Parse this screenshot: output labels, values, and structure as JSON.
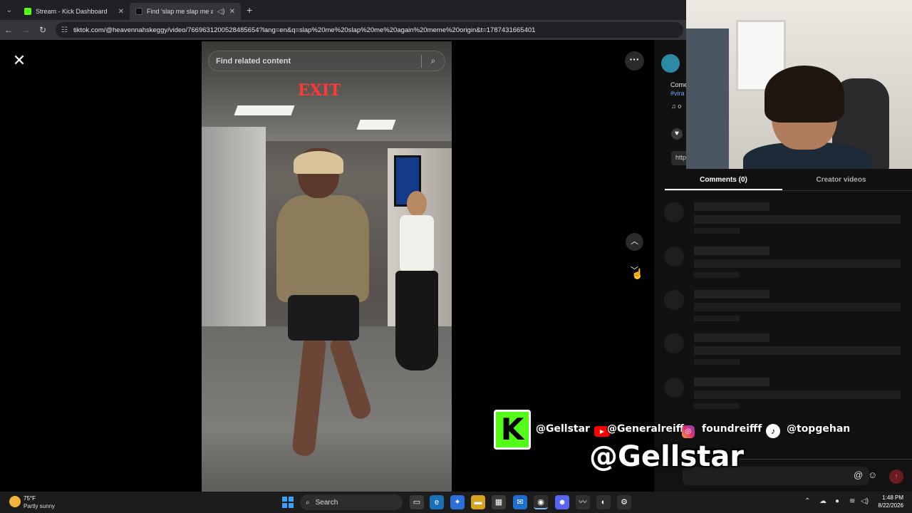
{
  "browser": {
    "tabs": [
      {
        "title": "Stream - Kick Dashboard",
        "favicon_color": "#53fc18"
      },
      {
        "title": "Find 'slap me slap me again",
        "favicon_color": "#111111"
      }
    ],
    "url": "tiktok.com/@heavennahskeggy/video/7669631200528485654?lang=en&q=slap%20me%20slap%20me%20again%20meme%20origin&t=1787431665401"
  },
  "viewer": {
    "search_placeholder": "Find related content",
    "exit_sign": "EXIT"
  },
  "side_info": {
    "description_fragment": "Come",
    "hashtag_fragment": "#vira",
    "music_fragment": "o",
    "link_fragment": "http"
  },
  "panel_tabs": {
    "comments": "Comments (0)",
    "creator_videos": "Creator videos"
  },
  "overlay": {
    "kick_letter": "K",
    "kick_handle": "@Gellstar",
    "youtube_handle": "@Generalreiff",
    "instagram_handle": "foundreifff",
    "tiktok_handle": "@topgehan",
    "big_handle": "@Gellstar"
  },
  "taskbar": {
    "temperature": "75°F",
    "weather": "Partly sunny",
    "search_label": "Search",
    "time": "1:48 PM",
    "date": "8/22/2026"
  }
}
